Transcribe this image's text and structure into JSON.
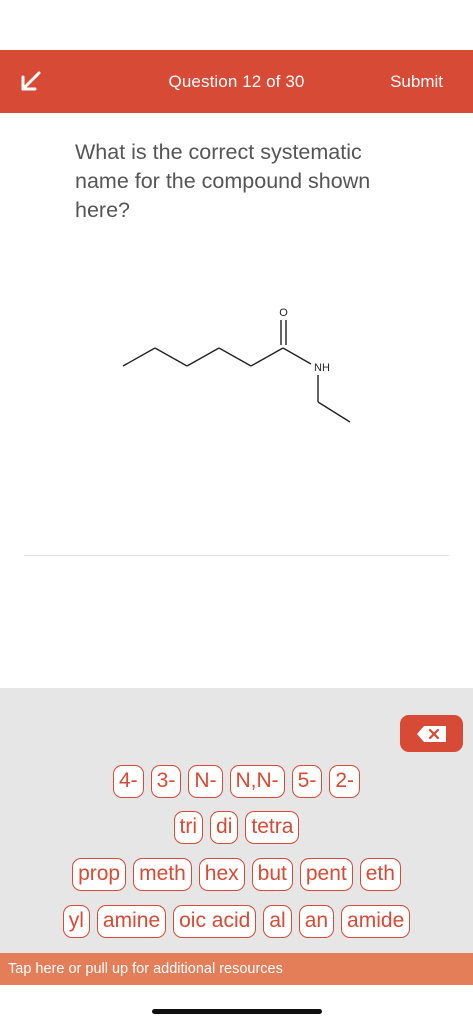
{
  "header": {
    "title": "Question 12 of 30",
    "submit_label": "Submit",
    "back_icon": "chevron-left-icon",
    "background": "#d74a35"
  },
  "question": {
    "text": "What is the correct systematic name for the compound shown here?"
  },
  "molecule": {
    "oxygen_label": "O",
    "nitrogen_label": "NH"
  },
  "keyboard": {
    "backspace_icon": "backspace-icon",
    "rows": [
      [
        "4-",
        "3-",
        "N-",
        "N,N-",
        "5-",
        "2-"
      ],
      [
        "tri",
        "di",
        "tetra"
      ],
      [
        "prop",
        "meth",
        "hex",
        "but",
        "pent",
        "eth"
      ],
      [
        "yl",
        "amine",
        "oic acid",
        "al",
        "an",
        "amide"
      ]
    ],
    "accent": "#d74a35"
  },
  "resources": {
    "text": "Tap here or pull up for additional resources"
  }
}
